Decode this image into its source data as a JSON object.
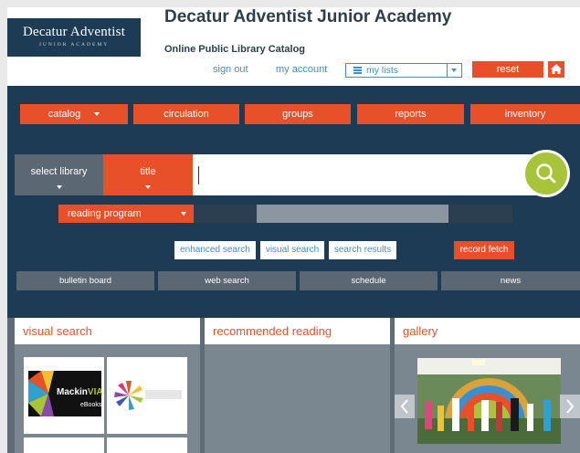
{
  "header": {
    "logo_line1": "Decatur Adventist",
    "logo_line2": "JUNIOR ACADEMY",
    "school_name": "Decatur Adventist Junior Academy",
    "catalog_label": "Online Public Library Catalog",
    "sign_out": "sign out",
    "my_account": "my account",
    "my_lists": "my lists",
    "reset": "reset",
    "home_icon": "home-icon"
  },
  "nav": {
    "catalog": "catalog",
    "circulation": "circulation",
    "groups": "groups",
    "reports": "reports",
    "inventory": "inventory"
  },
  "search": {
    "select_library": "select library",
    "search_type": "title",
    "query": "",
    "search_icon": "search-icon"
  },
  "reading_program": "reading program",
  "links": {
    "enhanced_search": "enhanced search",
    "visual_search": "visual search",
    "search_results": "search results",
    "record_fetch": "record fetch"
  },
  "sub_nav": {
    "bulletin_board": "bulletin board",
    "web_search": "web search",
    "schedule": "schedule",
    "news": "news"
  },
  "sections": {
    "visual_search": "visual search",
    "recommended_reading": "recommended reading",
    "gallery": "gallery"
  },
  "tiles": {
    "mackin_name": "Mackin",
    "mackin_via": "VIA",
    "mackin_sub": "eBooks"
  },
  "colors": {
    "accent": "#e8502a",
    "panel": "#1e3b55",
    "link": "#3b8fd0",
    "search_button": "#a8c43b"
  }
}
